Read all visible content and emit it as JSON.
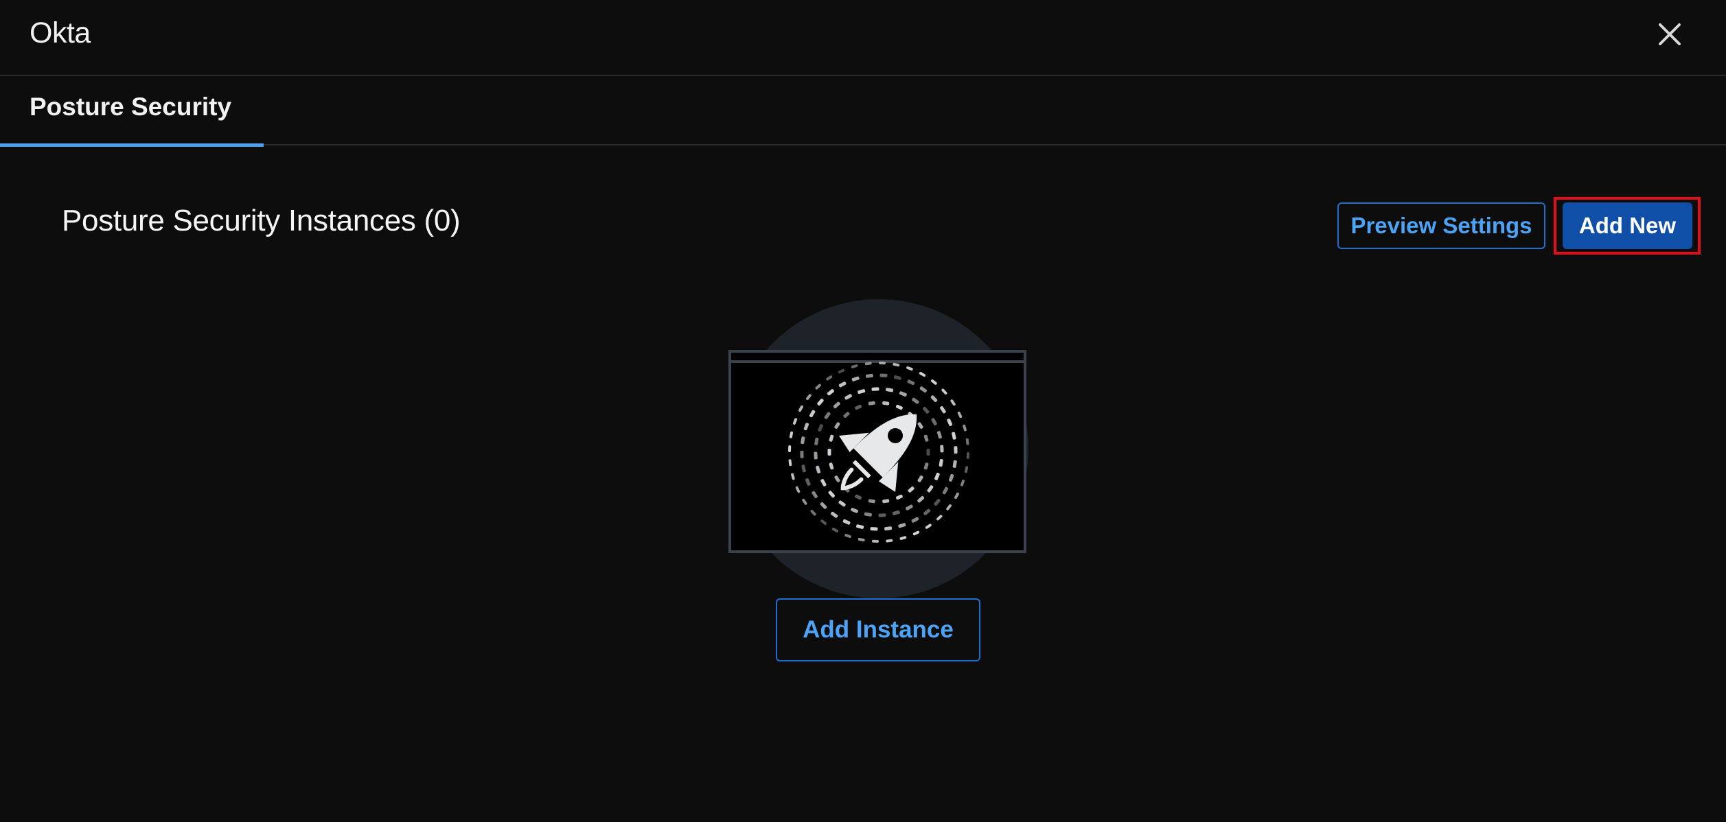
{
  "window": {
    "title": "Okta",
    "close_icon": "close-icon"
  },
  "tabs": [
    {
      "label": "Posture Security",
      "active": true
    }
  ],
  "section": {
    "title": "Posture Security Instances (0)"
  },
  "actions": {
    "preview_settings_label": "Preview Settings",
    "add_new_label": "Add New"
  },
  "empty_state": {
    "illustration_icon": "rocket-icon",
    "add_instance_label": "Add Instance"
  },
  "colors": {
    "background": "#0d0d0d",
    "accent": "#4a9eea",
    "primary_button": "#0f4fa8",
    "outline_border": "#1f6fd1",
    "highlight": "#e0101a"
  }
}
